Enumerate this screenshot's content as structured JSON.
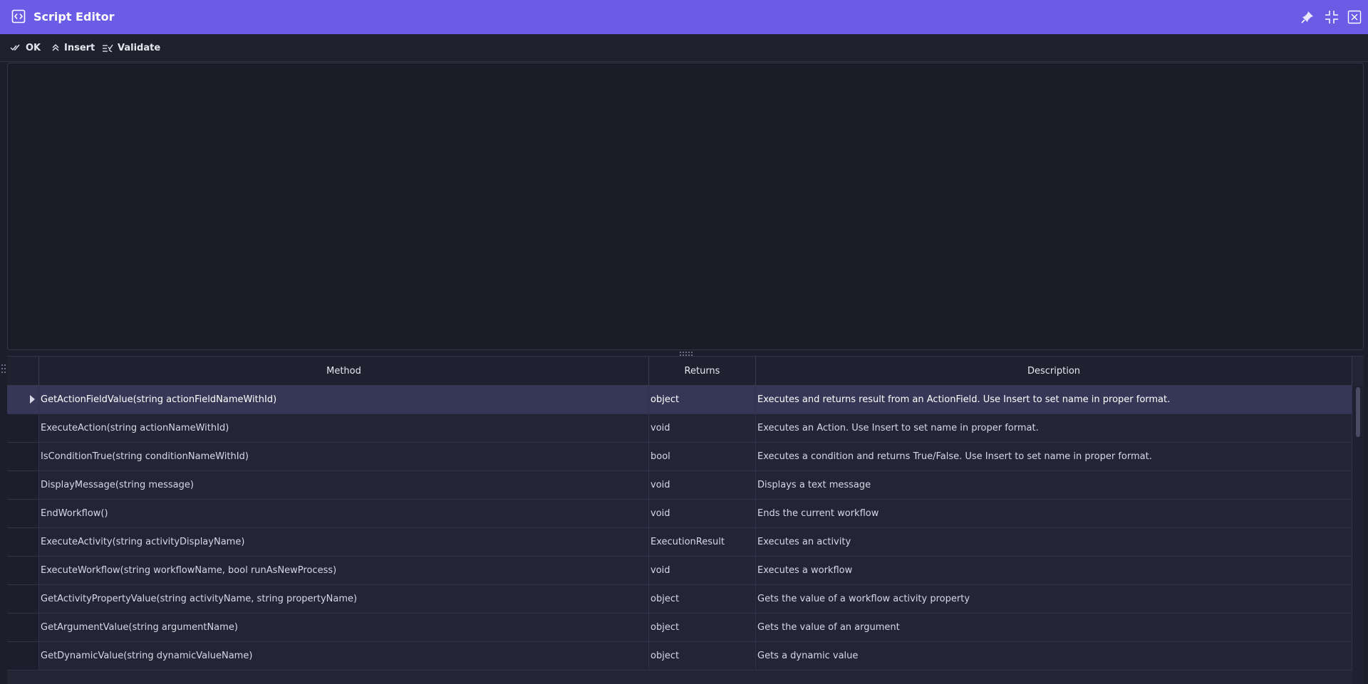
{
  "window": {
    "title": "Script Editor",
    "accent_color": "#6b5ce6",
    "icons": {
      "app": "code-brackets-icon",
      "pin": "pin-icon",
      "minimize": "collapse-icon",
      "close": "close-icon"
    }
  },
  "toolbar": {
    "ok_label": "OK",
    "insert_label": "Insert",
    "validate_label": "Validate"
  },
  "editor": {
    "content": ""
  },
  "grid": {
    "columns": [
      "Method",
      "Returns",
      "Description"
    ],
    "rows": [
      {
        "method": "GetActionFieldValue(string actionFieldNameWithId)",
        "returns": "object",
        "description": "Executes and returns result from an ActionField. Use Insert to set name in proper format.",
        "selected": true
      },
      {
        "method": "ExecuteAction(string actionNameWithId)",
        "returns": "void",
        "description": "Executes an Action. Use Insert to set name in proper format."
      },
      {
        "method": "IsConditionTrue(string conditionNameWithId)",
        "returns": "bool",
        "description": "Executes a condition and returns True/False. Use Insert to set name in proper format."
      },
      {
        "method": "DisplayMessage(string message)",
        "returns": "void",
        "description": "Displays a text message"
      },
      {
        "method": "EndWorkflow()",
        "returns": "void",
        "description": "Ends the current workflow"
      },
      {
        "method": "ExecuteActivity(string activityDisplayName)",
        "returns": "ExecutionResult",
        "description": "Executes an activity"
      },
      {
        "method": "ExecuteWorkflow(string workflowName, bool runAsNewProcess)",
        "returns": "void",
        "description": "Executes a workflow"
      },
      {
        "method": "GetActivityPropertyValue(string activityName, string propertyName)",
        "returns": "object",
        "description": "Gets the value of a workflow activity property"
      },
      {
        "method": "GetArgumentValue(string argumentName)",
        "returns": "object",
        "description": "Gets the value of an argument"
      },
      {
        "method": "GetDynamicValue(string dynamicValueName)",
        "returns": "object",
        "description": "Gets a dynamic value"
      }
    ]
  }
}
